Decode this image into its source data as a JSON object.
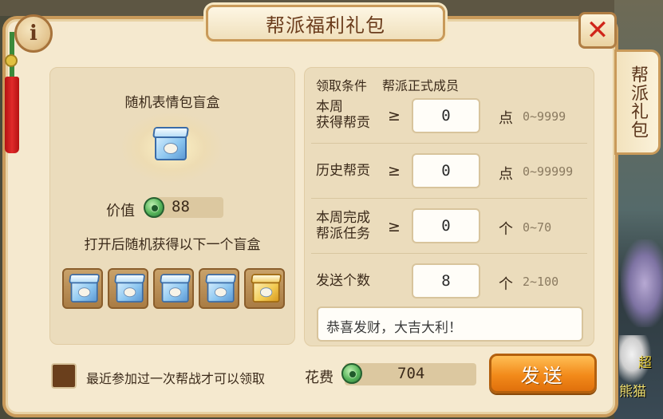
{
  "title": "帮派福利礼包",
  "side_tab": "帮派礼包",
  "pack": {
    "name": "随机表情包盲盒",
    "value_label": "价值",
    "value": "88",
    "random_text": "打开后随机获得以下一个盲盒",
    "slots": [
      "blue-box-icon",
      "blue-box-icon",
      "blue-box-icon",
      "blue-box-icon",
      "gold-box-icon"
    ]
  },
  "conditions": {
    "label": "领取条件",
    "value": "帮派正式成员"
  },
  "rows": [
    {
      "label_line1": "本周",
      "label_line2": "获得帮贡",
      "op": "≥",
      "input": "0",
      "unit": "点",
      "range": "0~9999"
    },
    {
      "label_line1": "历史帮贡",
      "label_line2": "",
      "op": "≥",
      "input": "0",
      "unit": "点",
      "range": "0~99999"
    },
    {
      "label_line1": "本周完成",
      "label_line2": "帮派任务",
      "op": "≥",
      "input": "0",
      "unit": "个",
      "range": "0~70"
    },
    {
      "label_line1": "发送个数",
      "label_line2": "",
      "op": "",
      "input": "8",
      "unit": "个",
      "range": "2~100"
    }
  ],
  "message": "恭喜发财，大吉大利！",
  "footer": {
    "checkbox_label": "最近参加过一次帮战才可以领取",
    "cost_label": "花费",
    "cost": "704",
    "send_label": "发送"
  },
  "background_text": [
    "超",
    "熊猫"
  ],
  "colors": {
    "panel_bg": "#f5e9cf",
    "border": "#c99a5a",
    "send_button": "#f28a1a",
    "close_x": "#d0261a"
  }
}
